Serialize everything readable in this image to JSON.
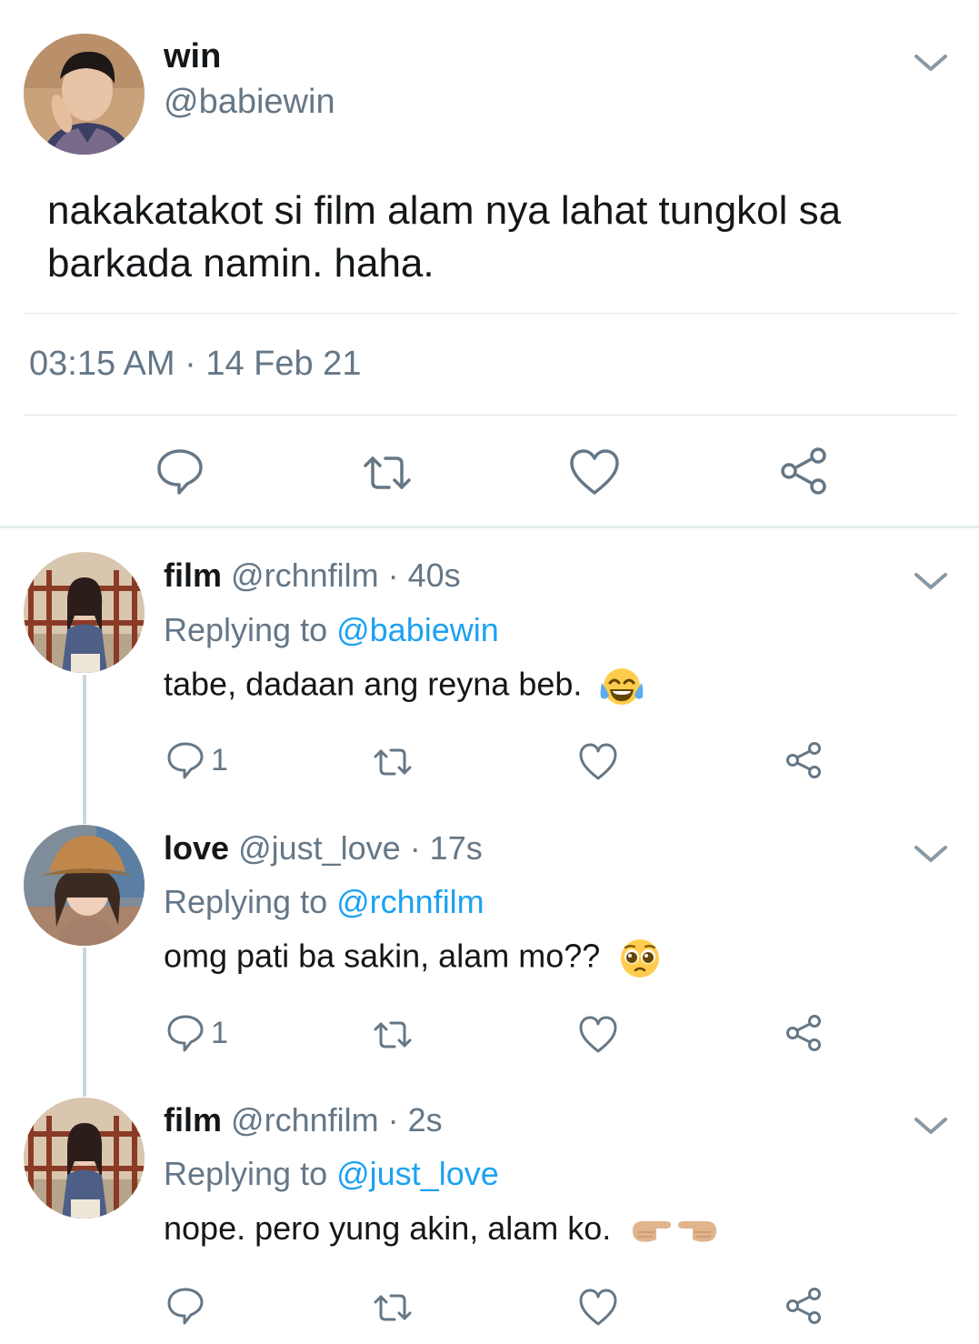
{
  "tweet": {
    "author_name": "win",
    "author_handle": "@babiewin",
    "text": "nakakatakot si film alam nya lahat tungkol sa barkada namin. haha.",
    "timestamp": "03:15 AM · 14 Feb 21",
    "actions": [
      "reply-icon",
      "retweet-icon",
      "like-icon",
      "share-icon"
    ]
  },
  "replies": [
    {
      "name": "film",
      "handle_time": "@rchnfilm · 40s",
      "replying_prefix": "Replying to ",
      "replying_to": "@babiewin",
      "text": "tabe, dadaan ang reyna beb.",
      "emoji": "face-with-tears-of-joy",
      "reply_count": "1"
    },
    {
      "name": "love",
      "handle_time": "@just_love · 17s",
      "replying_prefix": "Replying to ",
      "replying_to": "@rchnfilm",
      "text": "omg pati ba sakin, alam mo??",
      "emoji": "pleading-face",
      "reply_count": "1"
    },
    {
      "name": "film",
      "handle_time": "@rchnfilm · 2s",
      "replying_prefix": "Replying to ",
      "replying_to": "@just_love",
      "text": "nope. pero yung akin, alam ko.",
      "emoji": "pointing-fingers",
      "reply_count": ""
    }
  ],
  "colors": {
    "text": "#14171a",
    "secondary": "#657786",
    "link": "#1da1f2",
    "icon": "#657786",
    "divider": "#e1e8ed",
    "thread_line": "#ccd6dd"
  }
}
